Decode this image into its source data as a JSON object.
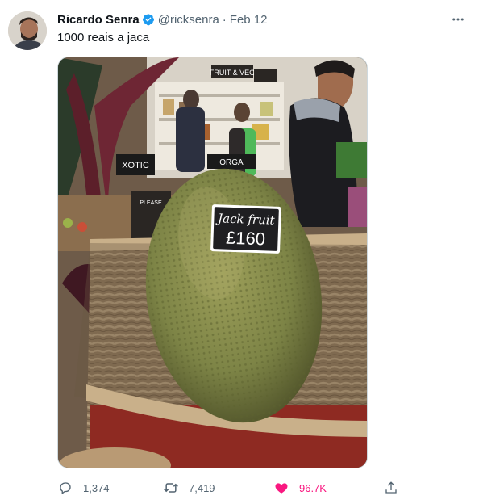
{
  "author": {
    "name": "Ricardo Senra",
    "handle": "@ricksenra",
    "separator": "·",
    "date": "Feb 12",
    "verified": true
  },
  "tweet_text": "1000 reais a jaca",
  "photo": {
    "sign": {
      "line1": "Jack fruit",
      "line2": "£160"
    },
    "shop_sign_1": "FRUIT & VEG",
    "shop_sign_2": "XOTIC",
    "shop_sign_3": "ORGA",
    "shop_sign_4": "PLEASE"
  },
  "actions": {
    "reply_count": "1,374",
    "retweet_count": "7,419",
    "like_count": "96.7K",
    "liked": true,
    "accent_like": "#f91880"
  },
  "icons": [
    "verified-badge-icon",
    "more-icon",
    "reply-icon",
    "retweet-icon",
    "heart-icon",
    "share-icon"
  ]
}
